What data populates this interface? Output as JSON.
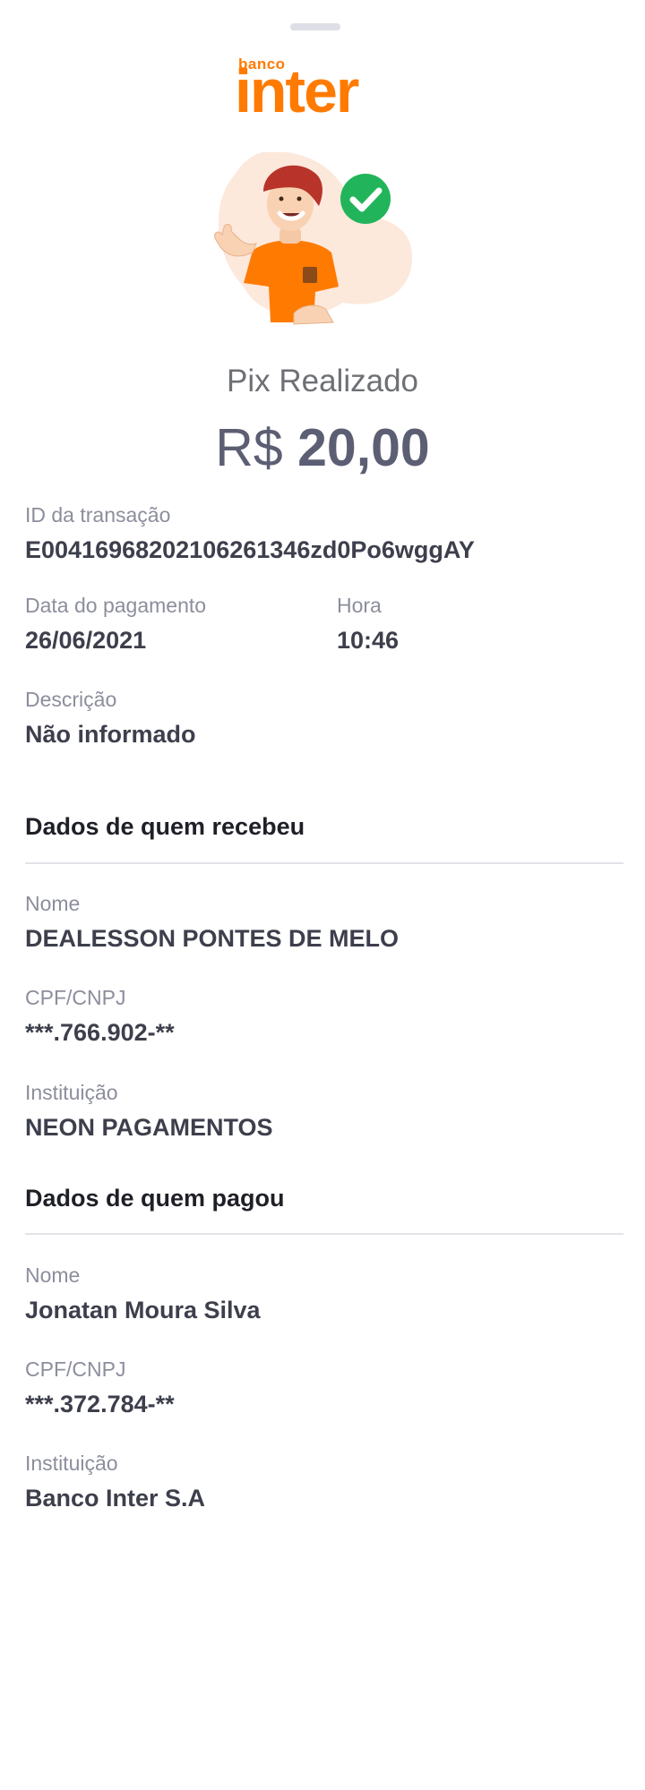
{
  "brand": {
    "small": "banco",
    "large": "inter",
    "color": "#ff7a00"
  },
  "status": {
    "title": "Pix Realizado",
    "currency": "R$",
    "amount": "20,00",
    "check_icon": "check-circle-icon",
    "check_color": "#22b45a"
  },
  "transaction": {
    "id_label": "ID da transação",
    "id_value": "E00416968202106261346zd0Po6wggAY",
    "date_label": "Data do pagamento",
    "date_value": "26/06/2021",
    "time_label": "Hora",
    "time_value": "10:46",
    "desc_label": "Descrição",
    "desc_value": "Não informado"
  },
  "receiver": {
    "section_title": "Dados de quem recebeu",
    "name_label": "Nome",
    "name_value": "DEALESSON PONTES DE MELO",
    "doc_label": "CPF/CNPJ",
    "doc_value": "***.766.902-**",
    "inst_label": "Instituição",
    "inst_value": "NEON PAGAMENTOS"
  },
  "payer": {
    "section_title": "Dados de quem pagou",
    "name_label": "Nome",
    "name_value": "Jonatan Moura Silva",
    "doc_label": "CPF/CNPJ",
    "doc_value": "***.372.784-**",
    "inst_label": "Instituição",
    "inst_value": "Banco Inter S.A"
  }
}
